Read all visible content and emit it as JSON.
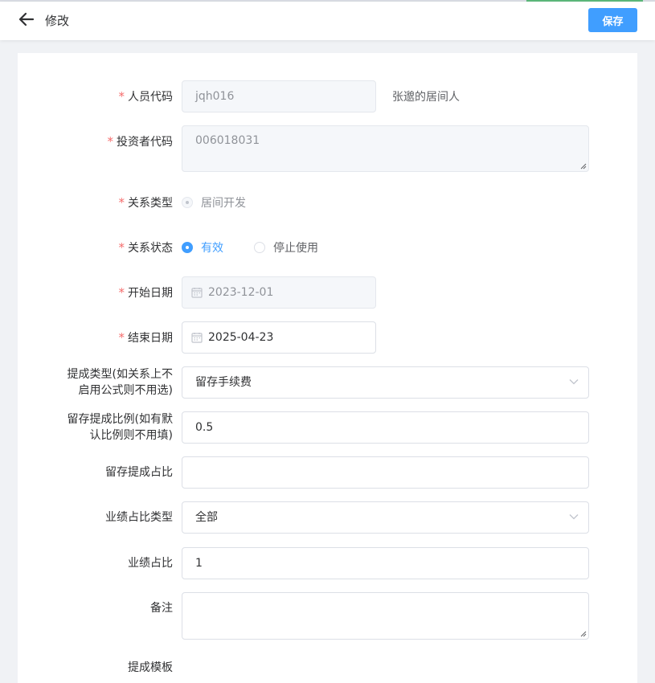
{
  "header": {
    "title": "修改",
    "save_label": "保存"
  },
  "colors": {
    "primary": "#409eff",
    "required": "#f56c6c",
    "disabled_bg": "#f5f7fa",
    "page_bg": "#f0f2f5"
  },
  "form": {
    "person_code": {
      "label": "人员代码",
      "value": "jqh016",
      "aside": "张邈的居间人",
      "required": true
    },
    "investor_code": {
      "label": "投资者代码",
      "value": "006018031",
      "required": true
    },
    "relation_type": {
      "label": "关系类型",
      "option": "居间开发",
      "required": true
    },
    "relation_status": {
      "label": "关系状态",
      "options": [
        "有效",
        "停止使用"
      ],
      "selected": "有效",
      "required": true
    },
    "start_date": {
      "label": "开始日期",
      "value": "2023-12-01",
      "required": true
    },
    "end_date": {
      "label": "结束日期",
      "value": "2025-04-23",
      "required": true
    },
    "commission_type": {
      "label_line1": "提成类型(如关系上不",
      "label_line2": "启用公式则不用选)",
      "value": "留存手续费"
    },
    "retain_ratio": {
      "label_line1": "留存提成比例(如有默",
      "label_line2": "认比例则不用填)",
      "value": "0.5"
    },
    "retain_share": {
      "label": "留存提成占比",
      "value": ""
    },
    "perf_share_type": {
      "label": "业绩占比类型",
      "value": "全部"
    },
    "perf_share": {
      "label": "业绩占比",
      "value": "1"
    },
    "remark": {
      "label": "备注",
      "value": ""
    },
    "commission_template": {
      "label": "提成模板"
    }
  },
  "icons": {
    "back": "arrow-left-icon",
    "calendar": "calendar-icon",
    "dropdown": "chevron-down-icon"
  }
}
